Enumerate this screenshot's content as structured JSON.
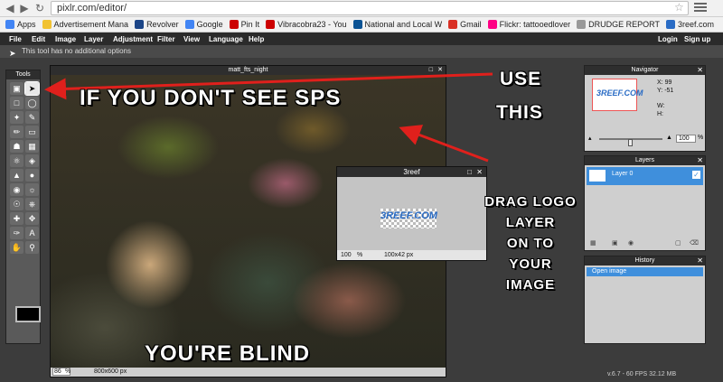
{
  "browser": {
    "url": "pixlr.com/editor/",
    "bookmarks": [
      {
        "label": "Apps",
        "color": "#4285f4"
      },
      {
        "label": "Advertisement Mana",
        "color": "#f1c232"
      },
      {
        "label": "Revolver",
        "color": "#1c4587"
      },
      {
        "label": "Google",
        "color": "#4285f4"
      },
      {
        "label": "Pin It",
        "color": "#cc0000"
      },
      {
        "label": "Vibracobra23 - You",
        "color": "#cc0000"
      },
      {
        "label": "National and Local W",
        "color": "#0b5394"
      },
      {
        "label": "Gmail",
        "color": "#d93025"
      },
      {
        "label": "Flickr: tattooedlover",
        "color": "#ff0084"
      },
      {
        "label": "DRUDGE REPORT",
        "color": "#999999"
      },
      {
        "label": "3reef.com",
        "color": "#2a6cc5"
      }
    ]
  },
  "menu": {
    "items": [
      "File",
      "Edit",
      "Image",
      "Layer",
      "Adjustment",
      "Filter",
      "View",
      "Language",
      "Help"
    ],
    "login": "Login",
    "signup": "Sign up"
  },
  "options_bar": {
    "text": "This tool has no additional options"
  },
  "tools_panel": {
    "title": "Tools"
  },
  "image_window": {
    "title": "matt_fts_night",
    "zoom": "86",
    "zoom_unit": "%",
    "size": "800x600 px"
  },
  "logo_window": {
    "title": "3reef",
    "zoom": "100",
    "zoom_unit": "%",
    "size": "100x42 px",
    "logo": "3REEF.COM"
  },
  "navigator": {
    "title": "Navigator",
    "x_label": "X:",
    "x_value": "99",
    "y_label": "Y:",
    "y_value": "-51",
    "w_label": "W:",
    "h_label": "H:",
    "zoom": "100",
    "zoom_unit": "%"
  },
  "layers": {
    "title": "Layers",
    "layer_name": "Layer 0"
  },
  "history": {
    "title": "History",
    "item": "Open image"
  },
  "status": "v.6.7 - 60 FPS 32.12 MB",
  "annotations": {
    "top": "IF YOU DON'T SEE SPS",
    "bottom": "YOU'RE BLIND",
    "use": "USE",
    "this": "THIS",
    "drag": [
      "DRAG LOGO",
      "LAYER",
      "ON TO",
      "YOUR",
      "IMAGE"
    ]
  }
}
